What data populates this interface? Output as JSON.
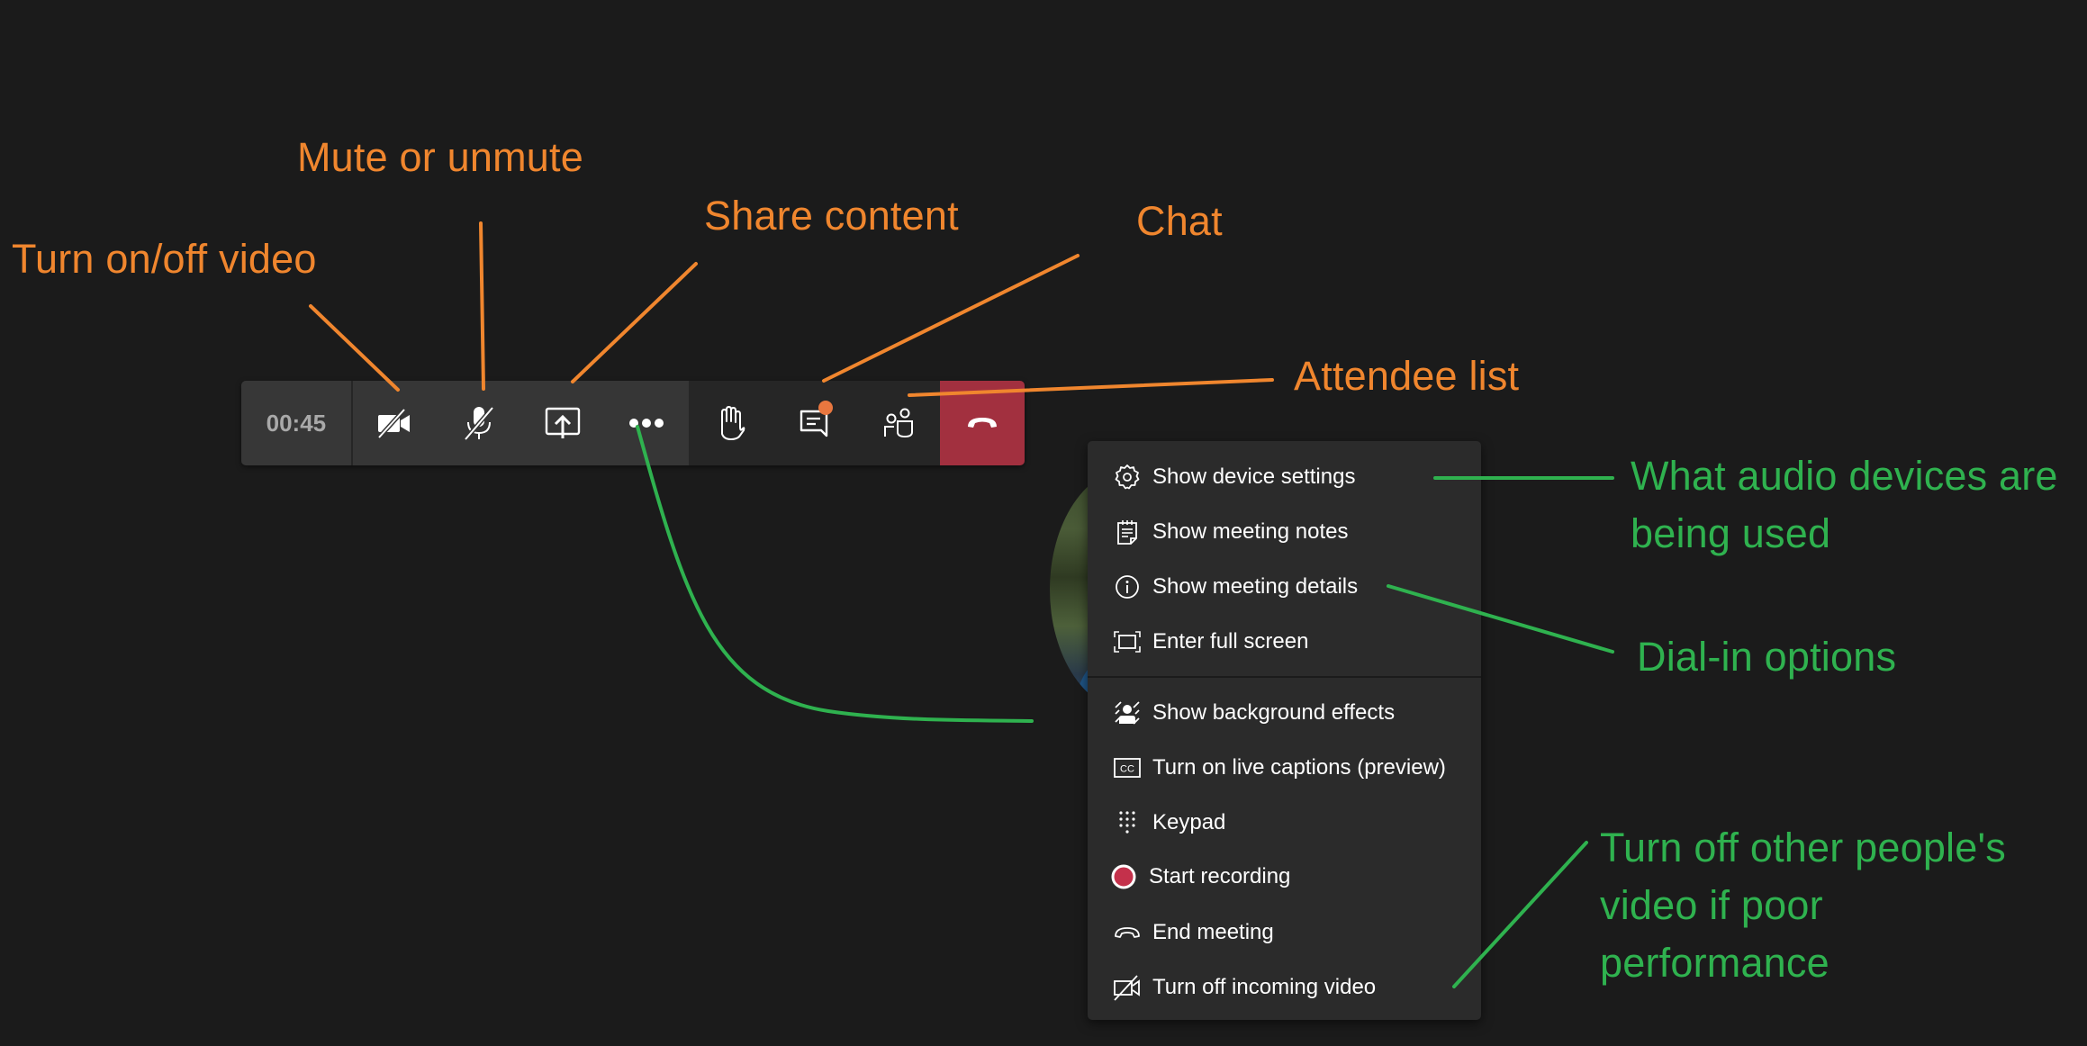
{
  "toolbar": {
    "timer": "00:45",
    "buttons": [
      {
        "id": "video",
        "icon": "video-off-icon",
        "label": "Turn on/off video"
      },
      {
        "id": "mic",
        "icon": "mic-off-icon",
        "label": "Mute or unmute"
      },
      {
        "id": "share",
        "icon": "share-screen-icon",
        "label": "Share content"
      },
      {
        "id": "more",
        "icon": "more-options-icon",
        "label": "More actions"
      },
      {
        "id": "hand",
        "icon": "raise-hand-icon",
        "label": "Raise hand"
      },
      {
        "id": "chat",
        "icon": "chat-icon",
        "label": "Chat",
        "has_notification": true
      },
      {
        "id": "people",
        "icon": "people-icon",
        "label": "Attendee list"
      },
      {
        "id": "hangup",
        "icon": "hang-up-icon",
        "label": "Leave"
      }
    ],
    "colors": {
      "hangup": "#a2303f",
      "notification": "#e9773f"
    }
  },
  "menu": {
    "items": [
      {
        "icon": "gear-icon",
        "label": "Show device settings"
      },
      {
        "icon": "notes-icon",
        "label": "Show meeting notes"
      },
      {
        "icon": "info-icon",
        "label": "Show meeting details"
      },
      {
        "icon": "fullscreen-icon",
        "label": "Enter full screen"
      },
      {
        "icon": "background-effects-icon",
        "label": "Show background effects"
      },
      {
        "icon": "closed-captions-icon",
        "label": "Turn on live captions (preview)"
      },
      {
        "icon": "keypad-icon",
        "label": "Keypad"
      },
      {
        "icon": "record-icon",
        "label": "Start recording"
      },
      {
        "icon": "end-call-icon",
        "label": "End meeting"
      },
      {
        "icon": "video-off-icon",
        "label": "Turn off incoming video"
      }
    ],
    "record_color": "#c4314b"
  },
  "annotations": {
    "orange_color": "#f0862e",
    "green_color": "#2fb24f",
    "video": "Turn on/off video",
    "mute": "Mute or unmute",
    "share": "Share content",
    "chat": "Chat",
    "attendees": "Attendee list",
    "audio_devices_line1": "What audio devices are",
    "audio_devices_line2": "being used",
    "dial_in": "Dial-in options",
    "incoming_video_line1": "Turn off other people's",
    "incoming_video_line2": "video if poor",
    "incoming_video_line3": "performance"
  }
}
